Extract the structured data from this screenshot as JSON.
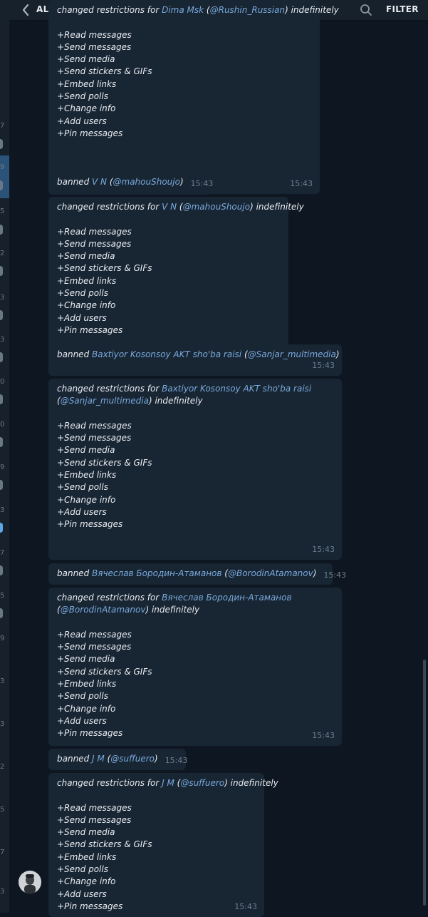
{
  "header": {
    "title": "ALL ACTIONS",
    "filter_label": "FILTER"
  },
  "left_column_numbers": [
    "7",
    "9",
    "5",
    "2",
    "3",
    "3",
    "0",
    "0",
    "9",
    "3",
    "7",
    "5",
    "9",
    "3",
    "3",
    "2",
    "5",
    "7",
    "3"
  ],
  "messages": [
    {
      "type": "restriction",
      "prefix": "changed restrictions for ",
      "name": "Dima Msk",
      "username": "@Rushin_Russian",
      "suffix": " indefinitely",
      "permissions": [
        "+Read messages",
        "+Send messages",
        "+Send media",
        "+Send stickers & GIFs",
        "+Embed links",
        "+Send polls",
        "+Change info",
        "+Add users",
        "+Pin messages"
      ],
      "time": "15:43"
    },
    {
      "type": "ban",
      "prefix": "banned ",
      "name": "V N",
      "username": "@mahouShoujo",
      "time": "15:43"
    },
    {
      "type": "restriction",
      "prefix": "changed restrictions for ",
      "name": "V N",
      "username": "@mahouShoujo",
      "suffix": " indefinitely",
      "permissions": [
        "+Read messages",
        "+Send messages",
        "+Send media",
        "+Send stickers & GIFs",
        "+Embed links",
        "+Send polls",
        "+Change info",
        "+Add users",
        "+Pin messages"
      ],
      "time": "15:43"
    },
    {
      "type": "ban",
      "prefix": "banned ",
      "name": "Baxtiyor Kosonsoy AKT sho'ba raisi",
      "username": "@Sanjar_multimedia",
      "time": "15:43"
    },
    {
      "type": "restriction",
      "prefix": "changed restrictions for ",
      "name": "Baxtiyor Kosonsoy AKT sho'ba raisi",
      "username": "@Sanjar_multimedia",
      "suffix": " indefinitely",
      "permissions": [
        "+Read messages",
        "+Send messages",
        "+Send media",
        "+Send stickers & GIFs",
        "+Embed links",
        "+Send polls",
        "+Change info",
        "+Add users",
        "+Pin messages"
      ],
      "time": "15:43"
    },
    {
      "type": "ban",
      "prefix": "banned ",
      "name": "Вячеслав Бородин-Атаманов",
      "username": "@BorodinAtamanov",
      "time": "15:43"
    },
    {
      "type": "restriction",
      "prefix": "changed restrictions for ",
      "name": "Вячеслав Бородин-Атаманов",
      "username": "@BorodinAtamanov",
      "suffix": " indefinitely",
      "permissions": [
        "+Read messages",
        "+Send messages",
        "+Send media",
        "+Send stickers & GIFs",
        "+Embed links",
        "+Send polls",
        "+Change info",
        "+Add users",
        "+Pin messages"
      ],
      "time": "15:43"
    },
    {
      "type": "ban",
      "prefix": "banned ",
      "name": "J M",
      "username": "@suffuero",
      "time": "15:43"
    },
    {
      "type": "restriction",
      "prefix": "changed restrictions for ",
      "name": "J M",
      "username": "@suffuero",
      "suffix": " indefinitely",
      "permissions": [
        "+Read messages",
        "+Send messages",
        "+Send media",
        "+Send stickers & GIFs",
        "+Embed links",
        "+Send polls",
        "+Change info",
        "+Add users",
        "+Pin messages"
      ],
      "time": "15:43"
    }
  ],
  "colors": {
    "background": "#0e1621",
    "bubble": "#182533",
    "link": "#79a9dc",
    "time": "#6d7f8f",
    "header": "#17212b"
  }
}
